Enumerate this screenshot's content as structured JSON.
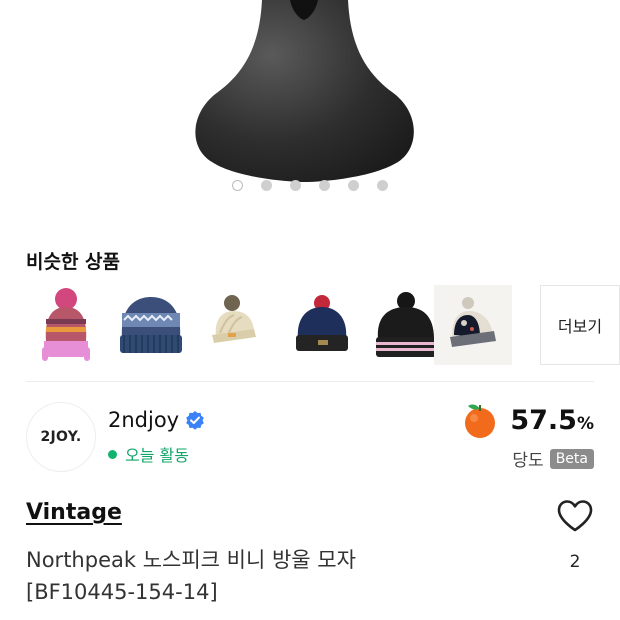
{
  "gallery": {
    "page_count": 6,
    "active_index": 0
  },
  "similar": {
    "title": "비슷한 상품",
    "items": [
      {
        "name": "pink-striped-pompom-beanie"
      },
      {
        "name": "blue-fair-isle-beanie"
      },
      {
        "name": "cream-knit-pompom-beanie"
      },
      {
        "name": "navy-pompom-beanie"
      },
      {
        "name": "black-striped-pompom-beanie"
      },
      {
        "name": "black-patterned-pompom-beanie"
      }
    ],
    "more_label": "더보기"
  },
  "seller": {
    "avatar_text": "2JOY.",
    "name": "2ndjoy",
    "status": "오늘 활동",
    "score_value": "57.5",
    "score_unit": "%",
    "score_label": "당도",
    "score_badge": "Beta"
  },
  "product": {
    "brand": "Vintage",
    "name_line1": "Northpeak 노스피크 비니 방울 모자",
    "name_line2": "[BF10445-154-14]",
    "likes": "2"
  },
  "colors": {
    "accent_green": "#12b36f",
    "verified_blue": "#3b82f6",
    "score_orange": "#f26b1d"
  }
}
